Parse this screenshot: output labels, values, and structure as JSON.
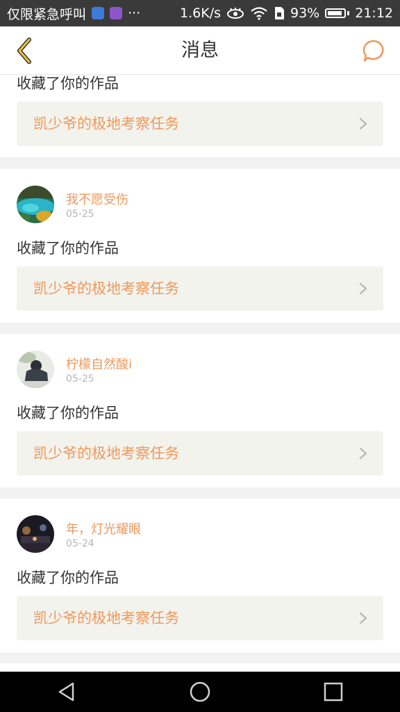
{
  "status_bar": {
    "carrier": "仅限紧急呼叫",
    "more": "···",
    "speed": "1.6K/s",
    "battery": "93%",
    "time": "21:12"
  },
  "header": {
    "title": "消息"
  },
  "colors": {
    "accent": "#f0985a",
    "link_bg": "#f3f3ee",
    "page_bg": "#f2f2f2"
  },
  "messages": [
    {
      "action": "收藏了你的作品",
      "work": "凯少爷的极地考察任务"
    },
    {
      "username": "我不愿受伤",
      "date": "05-25",
      "action": "收藏了你的作品",
      "work": "凯少爷的极地考察任务"
    },
    {
      "username": "柠檬自然酸i",
      "date": "05-25",
      "action": "收藏了你的作品",
      "work": "凯少爷的极地考察任务"
    },
    {
      "username": "年，灯光耀眼",
      "date": "05-24",
      "action": "收藏了你的作品",
      "work": "凯少爷的极地考察任务"
    }
  ],
  "icons": {
    "back": "chevron-left-icon",
    "chat": "chat-bubble-icon",
    "nav_back": "triangle-back-icon",
    "nav_home": "circle-home-icon",
    "nav_recent": "square-recent-icon"
  }
}
